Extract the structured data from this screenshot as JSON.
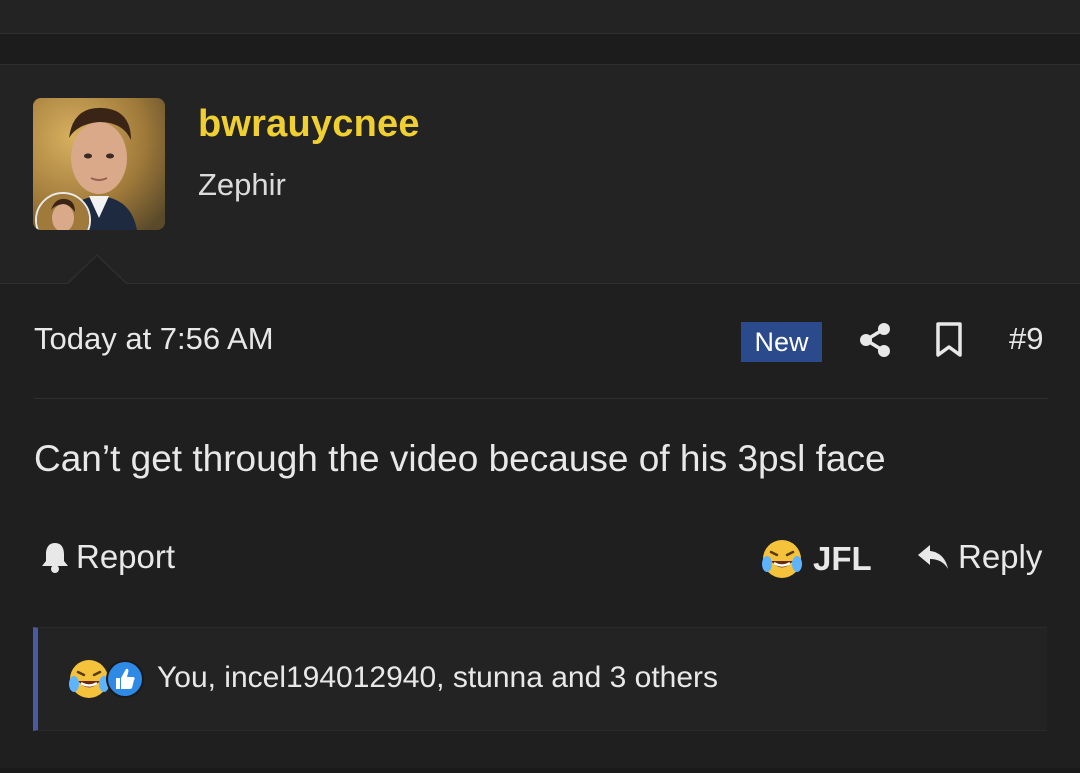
{
  "user": {
    "username": "bwrauycnee",
    "title": "Zephir"
  },
  "post": {
    "timestamp": "Today at 7:56 AM",
    "badge": "New",
    "number": "#9",
    "message": "Can’t get through the video because of his 3psl face"
  },
  "actions": {
    "report_label": "Report",
    "reaction_label": "JFL",
    "reply_label": "Reply"
  },
  "reactions": {
    "summary": "You, incel194012940, stunna and 3 others"
  },
  "colors": {
    "username": "#f0d030",
    "badge_bg": "#2b4a8c",
    "reaction_bar_accent": "#4a5aa0"
  }
}
